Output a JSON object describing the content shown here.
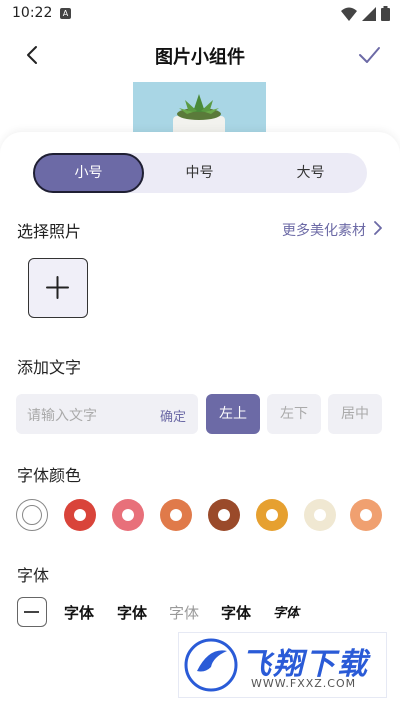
{
  "status_bar": {
    "time": "10:22",
    "notif_letter": "A",
    "icons": [
      "wifi-icon",
      "signal-icon",
      "battery-icon"
    ]
  },
  "header": {
    "title": "图片小组件",
    "back_icon": "chevron-left-icon",
    "confirm_icon": "checkmark-icon"
  },
  "size_tabs": {
    "items": [
      {
        "label": "小号",
        "active": true
      },
      {
        "label": "中号",
        "active": false
      },
      {
        "label": "大号",
        "active": false
      }
    ]
  },
  "photo_section": {
    "label": "选择照片",
    "more_label": "更多美化素材",
    "add_icon": "plus-icon"
  },
  "text_section": {
    "label": "添加文字",
    "input_placeholder": "请输入文字",
    "confirm_label": "确定",
    "positions": [
      {
        "label": "左上",
        "active": true
      },
      {
        "label": "左下",
        "active": false
      },
      {
        "label": "居中",
        "active": false
      }
    ]
  },
  "color_section": {
    "label": "字体颜色",
    "swatches": [
      "#ffffff",
      "#d9443a",
      "#e8707a",
      "#e07a4a",
      "#9a4a2a",
      "#e6a030",
      "#f0e8d2",
      "#f0a070"
    ]
  },
  "font_section": {
    "label": "字体",
    "options": [
      "字体",
      "字体",
      "字体",
      "字体",
      "字体"
    ]
  },
  "watermark": {
    "brand": "飞翔下载",
    "url": "WWW.FXXZ.COM"
  },
  "colors": {
    "accent": "#6c6aa6",
    "tab_bg": "#ecebf6"
  }
}
